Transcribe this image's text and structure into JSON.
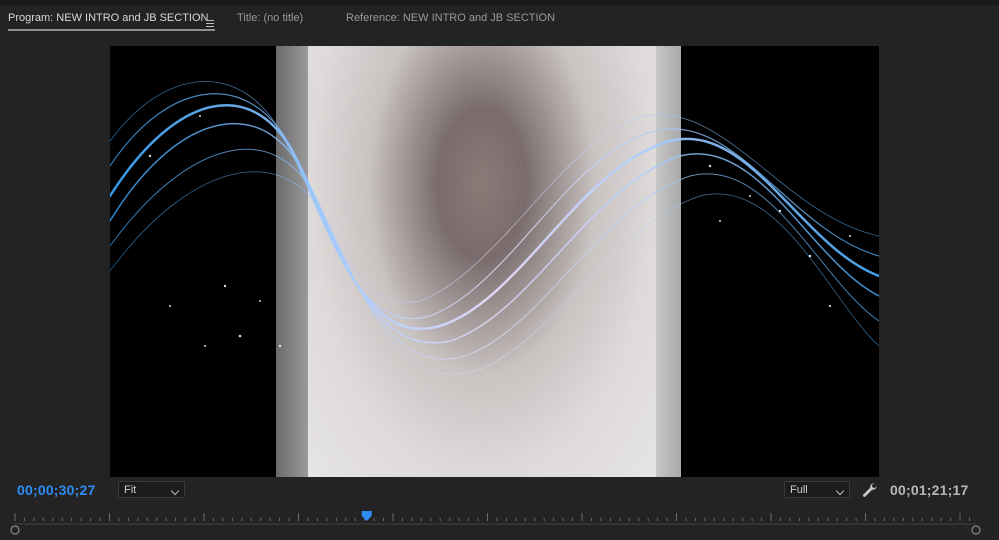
{
  "tabs": [
    {
      "label": "Program: NEW INTRO and JB SECTION",
      "active": true
    },
    {
      "label": "Title: (no title)",
      "active": false
    },
    {
      "label": "Reference: NEW INTRO and JB SECTION",
      "active": false
    }
  ],
  "icons": {
    "menu": "hamburger-menu-icon",
    "wrench": "wrench-icon",
    "playhead": "playhead-icon",
    "chevron": "chevron-down-icon"
  },
  "controls": {
    "timecode_current": "00;00;30;27",
    "zoom_label": "Fit",
    "resolution_label": "Full",
    "timecode_duration": "00;01;21;17"
  },
  "playhead": {
    "position": 0.366
  },
  "colors": {
    "accent": "#2f8cf5",
    "panel_bg": "#232323",
    "viewer_bg": "#000000"
  }
}
